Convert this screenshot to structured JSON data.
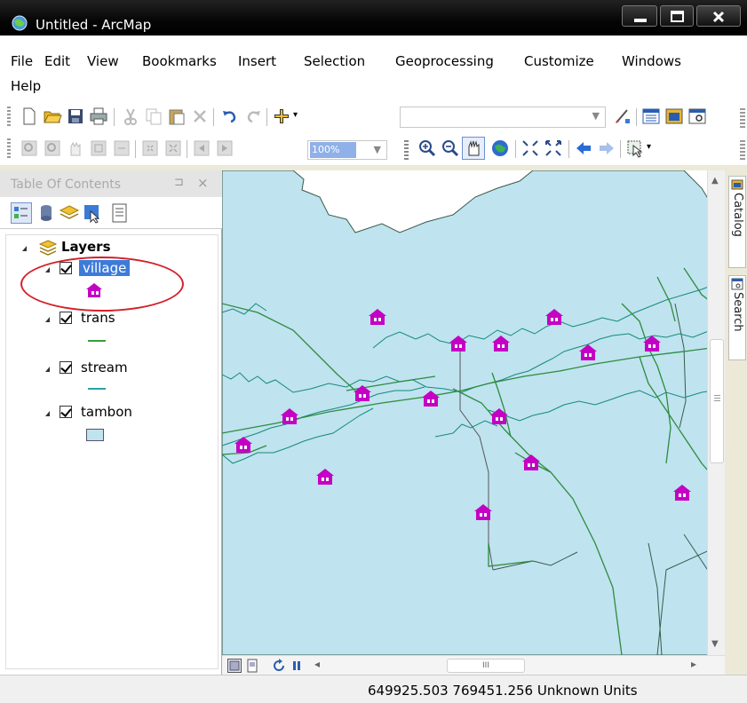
{
  "window": {
    "title": "Untitled - ArcMap",
    "minimize_label": "",
    "maximize_label": "",
    "close_label": ""
  },
  "menu": {
    "items": [
      "File",
      "Edit",
      "View",
      "Bookmarks",
      "Insert",
      "Selection",
      "Geoprocessing",
      "Customize",
      "Windows",
      "Help"
    ]
  },
  "toolbar": {
    "scale_value": "",
    "zoom_value": "100%"
  },
  "toc": {
    "title": "Table Of Contents",
    "pin_glyph": "⊐",
    "close_glyph": "×",
    "root_label": "Layers",
    "layers": [
      {
        "name": "village",
        "selected": true,
        "checked": true,
        "symbol": "house-icon",
        "symbol_color": "#cc00cc"
      },
      {
        "name": "trans",
        "selected": false,
        "checked": true,
        "symbol": "line",
        "symbol_color": "#3c9a3c"
      },
      {
        "name": "stream",
        "selected": false,
        "checked": true,
        "symbol": "line",
        "symbol_color": "#2aa3a3"
      },
      {
        "name": "tambon",
        "selected": false,
        "checked": true,
        "symbol": "polygon",
        "symbol_color": "#bfe3ef"
      }
    ]
  },
  "map": {
    "polygon_fill": "#bfe3ef",
    "road_color": "#2e8b3e",
    "stream_color": "#148a7a",
    "village_color": "#c400c4"
  },
  "dock": {
    "tabs": [
      "Catalog",
      "Search"
    ]
  },
  "status": {
    "coordinates": "649925.503  769451.256 Unknown Units"
  },
  "bottom": {
    "hscroll_glyph": "III"
  }
}
